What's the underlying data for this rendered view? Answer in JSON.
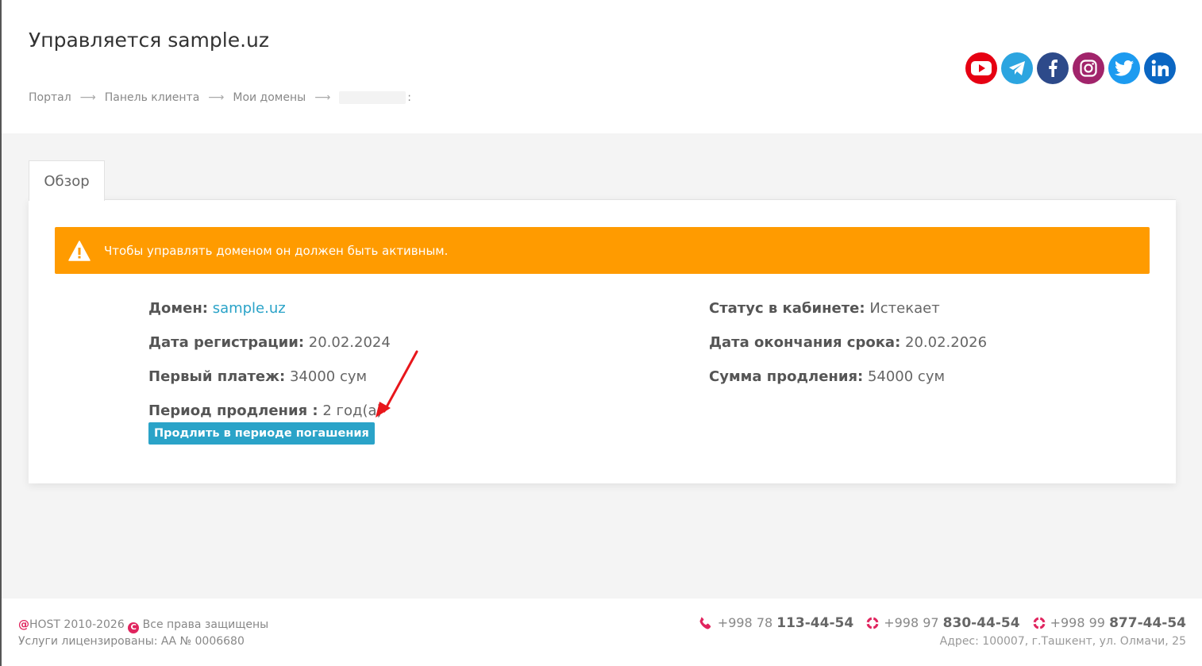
{
  "header": {
    "title": "Управляется sample.uz",
    "breadcrumb": [
      "Портал",
      "Панель клиента",
      "Мои домены"
    ],
    "breadcrumb_tail": ":"
  },
  "social": {
    "icons": [
      "youtube-icon",
      "telegram-icon",
      "facebook-icon",
      "instagram-icon",
      "twitter-icon",
      "linkedin-icon"
    ],
    "colors": [
      "#e60012",
      "#2ca5e0",
      "#2d4a8a",
      "#a1246b",
      "#1d9bf0",
      "#0b66c2"
    ]
  },
  "tabs": [
    {
      "label": "Обзор",
      "active": true
    }
  ],
  "alert": {
    "text": "Чтобы управлять доменом он должен быть активным.",
    "color": "#ff9b00"
  },
  "details": {
    "domain_label": "Домен:",
    "domain_value": "sample.uz",
    "reg_date_label": "Дата регистрации:",
    "reg_date_value": "20.02.2024",
    "first_payment_label": "Первый платеж:",
    "first_payment_value": "34000 сум",
    "period_label": "Период продления :",
    "period_value": "2 год(а)",
    "status_label": "Статус в кабинете:",
    "status_value": "Истекает",
    "expiry_label": "Дата окончания срока:",
    "expiry_value": "20.02.2026",
    "renew_sum_label": "Сумма продления:",
    "renew_sum_value": "54000 сум"
  },
  "renew_button": {
    "label": "Продлить в периоде погашения",
    "color": "#2aa3c8"
  },
  "footer": {
    "brand": "@",
    "copyright": "HOST 2010-2026",
    "copy_symbol": "C",
    "rights": "Все права защищены",
    "license": "Услуги лицензированы: АА № 0006680",
    "phones": [
      {
        "prefix": "+998 78",
        "number": "113-44-54"
      },
      {
        "prefix": "+998 97",
        "number": "830-44-54"
      },
      {
        "prefix": "+998 99",
        "number": "877-44-54"
      }
    ],
    "address": "Адрес: 100007, г.Ташкент, ул. Олмачи, 25"
  }
}
